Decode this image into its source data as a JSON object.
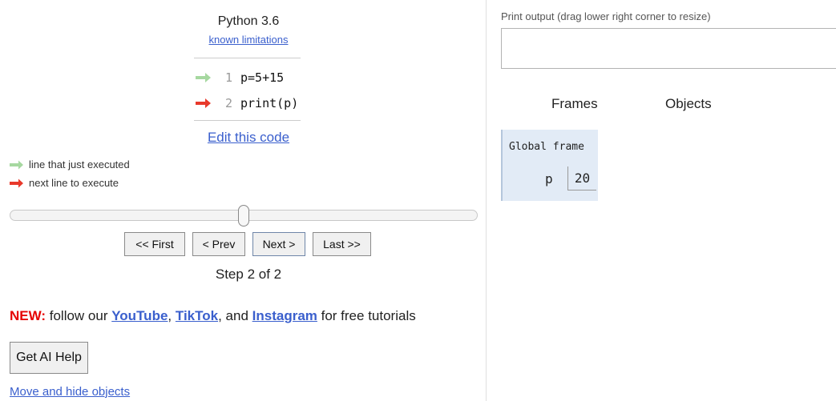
{
  "header": {
    "language": "Python 3.6",
    "limitations_link": "known limitations"
  },
  "code": {
    "lines": [
      {
        "number": "1",
        "text": "p=5+15",
        "arrow": "green-arrow"
      },
      {
        "number": "2",
        "text": "print(p)",
        "arrow": "red-arrow"
      }
    ],
    "edit_link": "Edit this code"
  },
  "legend": {
    "executed": "line that just executed",
    "next": "next line to execute"
  },
  "navigation": {
    "first": "<< First",
    "prev": "< Prev",
    "next": "Next >",
    "last": "Last >>",
    "step_text": "Step 2 of 2",
    "slider_fraction": 0.5
  },
  "promo": {
    "prefix": "NEW:",
    "text_follow": " follow our ",
    "youtube": "YouTube",
    "comma": ", ",
    "tiktok": "TikTok",
    "and": ", and ",
    "instagram": "Instagram",
    "suffix": " for free tutorials"
  },
  "ai_help_button": "Get AI Help",
  "move_hide_link": "Move and hide objects",
  "output": {
    "label": "Print output (drag lower right corner to resize)",
    "content": ""
  },
  "viz": {
    "frames_header": "Frames",
    "objects_header": "Objects",
    "global_frame_title": "Global frame",
    "variables": [
      {
        "name": "p",
        "value": "20"
      }
    ]
  },
  "colors": {
    "green_arrow": "#a6d8a0",
    "red_arrow": "#e8392b",
    "link": "#3a5fcd",
    "frame_bg": "#e2ebf6"
  }
}
